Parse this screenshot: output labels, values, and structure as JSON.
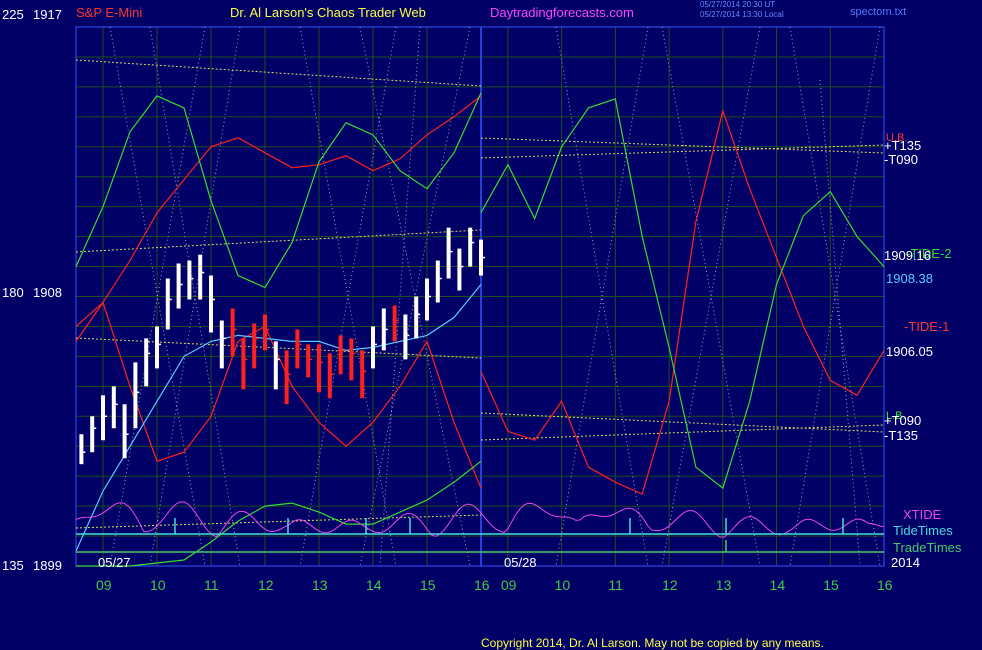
{
  "header": {
    "instrument": "S&P E-Mini",
    "site": "Dr. Al Larson's Chaos Trader Web",
    "url": "Daytradingforecasts.com",
    "timestamp_ut": "05/27/2014 20:30 UT",
    "timestamp_local": "05/27/2014 13:30 Local",
    "file": "spectom.txt"
  },
  "copyright": "Copyright 2014, Dr. Al Larson. May not be copied by any means.",
  "colors": {
    "background": "#000066",
    "grid": "#1e4d1e",
    "price_bar": "#ffffff",
    "price_down": "#ff2020",
    "tide1": "#ff2020",
    "tide2": "#33dd33",
    "cyan": "#55ccff",
    "yellow_cross": "#dddd66",
    "xtide": "#ee44ee",
    "tidetimes": "#44dddd",
    "tradetimes": "#44cc66"
  },
  "chart_data": {
    "type": "line",
    "title": "S&P E-Mini",
    "ylabel_left": [
      {
        "index": "225",
        "price": "1917"
      },
      {
        "index": "180",
        "price": "1908"
      },
      {
        "index": "135",
        "price": "1899"
      }
    ],
    "ylim": [
      1899,
      1917
    ],
    "xlim": [
      8.5,
      16
    ],
    "day1_label": "05/27",
    "day2_label": "05/28",
    "year_label": "2014",
    "x_ticks_day1": [
      "09",
      "10",
      "11",
      "12",
      "13",
      "14",
      "15",
      "16"
    ],
    "x_ticks_day2": [
      "09",
      "10",
      "11",
      "12",
      "13",
      "14",
      "15",
      "16"
    ],
    "right_labels": {
      "upper_t135": "+T135",
      "upper_t090": "-T090",
      "upper_name": "U.B.",
      "tide2_label": "-TIDE-2",
      "tide2_value": "1909.16",
      "cyan_value": "1908.38",
      "tide1_label": "-TIDE-1",
      "tide1_value": "1906.05",
      "lower_name": "L.B.",
      "lower_t090": "+T090",
      "lower_t135": "-T135",
      "xtide": "XTIDE",
      "tidetimes": "TideTimes",
      "tradetimes": "TradeTimes"
    },
    "series": [
      {
        "key": "tide1",
        "name": "-TIDE-1",
        "day": 2,
        "x": [
          8.5,
          9.0,
          9.5,
          10.0,
          10.5,
          11.0,
          11.5,
          12.0,
          12.5,
          13.0,
          13.5,
          14.0,
          14.5,
          15.0,
          15.5,
          16.0
        ],
        "y": [
          1905.5,
          1903.5,
          1903.2,
          1904.5,
          1902.3,
          1901.8,
          1901.4,
          1904.5,
          1910.5,
          1914.2,
          1911.6,
          1909.3,
          1907.0,
          1905.2,
          1904.7,
          1906.2
        ]
      },
      {
        "key": "tide2",
        "name": "-TIDE-2",
        "day": 2,
        "x": [
          8.5,
          9.0,
          9.5,
          10.0,
          10.5,
          11.0,
          11.5,
          12.0,
          12.5,
          13.0,
          13.5,
          14.0,
          14.5,
          15.0,
          15.5,
          16.0
        ],
        "y": [
          1910.8,
          1912.4,
          1910.6,
          1913.0,
          1914.3,
          1914.6,
          1910.0,
          1906.3,
          1902.3,
          1901.6,
          1904.5,
          1908.4,
          1910.7,
          1911.5,
          1910.0,
          1909.0
        ]
      },
      {
        "key": "tide1",
        "name": "tide1-day1",
        "day": 1,
        "x": [
          8.5,
          9.0,
          9.5,
          10.0,
          10.5,
          11.0,
          11.5,
          12.0,
          12.5,
          13.0,
          13.5,
          14.0,
          14.5,
          15.0,
          15.5,
          16.0
        ],
        "y": [
          1907.0,
          1907.8,
          1909.2,
          1910.8,
          1911.9,
          1913.0,
          1913.3,
          1912.8,
          1912.3,
          1912.4,
          1912.7,
          1912.2,
          1912.6,
          1913.4,
          1914.0,
          1914.7
        ]
      },
      {
        "key": "tide1",
        "name": "tide1-lower-day1",
        "day": 1,
        "x": [
          8.5,
          9.0,
          9.5,
          10.0,
          10.5,
          11.0,
          11.5,
          12.0,
          12.5,
          13.0,
          13.5,
          14.0,
          14.5,
          15.0,
          15.5,
          16.0
        ],
        "y": [
          1906.5,
          1907.8,
          1905.0,
          1902.5,
          1902.8,
          1904.0,
          1906.5,
          1907.0,
          1905.0,
          1903.8,
          1903.0,
          1903.8,
          1905.0,
          1906.5,
          1903.8,
          1901.6
        ]
      },
      {
        "key": "tide2",
        "name": "tide2-day1",
        "day": 1,
        "x": [
          8.5,
          9.0,
          9.5,
          10.0,
          10.5,
          11.0,
          11.5,
          12.0,
          12.5,
          13.0,
          13.5,
          14.0,
          14.5,
          15.0,
          15.5,
          16.0
        ],
        "y": [
          1909.0,
          1911.0,
          1913.5,
          1914.7,
          1914.3,
          1911.2,
          1908.7,
          1908.3,
          1909.8,
          1912.5,
          1913.8,
          1913.4,
          1912.2,
          1911.6,
          1912.8,
          1914.8
        ]
      },
      {
        "key": "tide2",
        "name": "tide2-lower-day1",
        "day": 1,
        "x": [
          8.5,
          9.5,
          10.5,
          11.0,
          11.5,
          12.0,
          12.5,
          13.0,
          13.5,
          14.0,
          14.5,
          15.0,
          15.5,
          16.0
        ],
        "y": [
          1899.0,
          1899.0,
          1899.2,
          1899.8,
          1900.5,
          1901.0,
          1901.1,
          1900.8,
          1900.4,
          1900.4,
          1900.8,
          1901.2,
          1901.8,
          1902.5
        ]
      },
      {
        "key": "cyan",
        "name": "cyan-day1",
        "day": 1,
        "x": [
          8.5,
          9.0,
          9.5,
          10.0,
          10.5,
          11.0,
          11.5,
          12.0,
          12.5,
          13.0,
          13.5,
          14.0,
          14.5,
          15.0,
          15.5,
          16.0
        ],
        "y": [
          1899.5,
          1901.5,
          1903.0,
          1904.5,
          1906.0,
          1906.5,
          1906.7,
          1906.6,
          1906.5,
          1906.5,
          1906.2,
          1906.3,
          1906.5,
          1906.7,
          1907.3,
          1908.4
        ]
      },
      {
        "key": "white",
        "name": "white-day1",
        "day": 1,
        "x": [
          8.5,
          10.0,
          10.5,
          11.0,
          11.5,
          12.0,
          12.5,
          13.0,
          13.5,
          14.0,
          14.5,
          15.0,
          15.5,
          16.0
        ],
        "y": [
          1899.0,
          1899.0,
          1900.2,
          1901.2,
          1901.9,
          1902.4,
          1902.8,
          1903.2,
          1903.6,
          1903.9,
          1904.2,
          1904.6,
          1905.2,
          1905.8
        ]
      }
    ],
    "price": {
      "x": [
        8.6,
        8.8,
        9.0,
        9.2,
        9.4,
        9.6,
        9.8,
        10.0,
        10.2,
        10.4,
        10.6,
        10.8,
        11.0,
        11.2,
        11.4,
        11.6,
        11.8,
        12.0,
        12.2,
        12.4,
        12.6,
        12.8,
        13.0,
        13.2,
        13.4,
        13.6,
        13.8,
        14.0,
        14.2,
        14.4,
        14.6,
        14.8,
        15.0,
        15.2,
        15.4,
        15.6,
        15.8,
        16.0
      ],
      "close": [
        1902.8,
        1903.6,
        1904.0,
        1904.4,
        1903.4,
        1904.8,
        1906.1,
        1906.4,
        1907.9,
        1908.4,
        1908.6,
        1908.8,
        1907.9,
        1906.6,
        1906.9,
        1905.9,
        1906.6,
        1906.9,
        1905.9,
        1905.4,
        1906.4,
        1905.9,
        1905.8,
        1905.4,
        1906.2,
        1906.1,
        1905.5,
        1906.4,
        1906.9,
        1907.2,
        1906.7,
        1907.4,
        1908.0,
        1908.6,
        1909.5,
        1909.0,
        1909.8,
        1909.3
      ],
      "high": [
        1903.4,
        1904.0,
        1904.7,
        1905.0,
        1904.4,
        1905.8,
        1906.6,
        1907.0,
        1908.6,
        1909.1,
        1909.2,
        1909.4,
        1908.7,
        1907.2,
        1907.6,
        1906.6,
        1907.1,
        1907.4,
        1906.5,
        1906.2,
        1906.9,
        1906.4,
        1906.4,
        1906.1,
        1906.7,
        1906.6,
        1906.2,
        1907.0,
        1907.6,
        1907.7,
        1907.4,
        1908.0,
        1908.6,
        1909.2,
        1910.3,
        1909.6,
        1910.3,
        1909.9
      ],
      "low": [
        1902.4,
        1902.8,
        1903.2,
        1903.6,
        1902.6,
        1903.6,
        1905.0,
        1905.6,
        1906.9,
        1907.6,
        1907.9,
        1907.9,
        1906.8,
        1905.6,
        1906.0,
        1904.9,
        1905.6,
        1906.2,
        1904.9,
        1904.4,
        1905.6,
        1905.3,
        1904.8,
        1904.6,
        1905.4,
        1905.2,
        1904.6,
        1905.6,
        1906.2,
        1906.5,
        1905.9,
        1906.6,
        1907.2,
        1907.8,
        1908.6,
        1908.2,
        1909.0,
        1908.7
      ],
      "down_ranges": [
        [
          11.3,
          12.1
        ],
        [
          12.35,
          13.8
        ],
        [
          14.35,
          14.5
        ]
      ]
    }
  }
}
